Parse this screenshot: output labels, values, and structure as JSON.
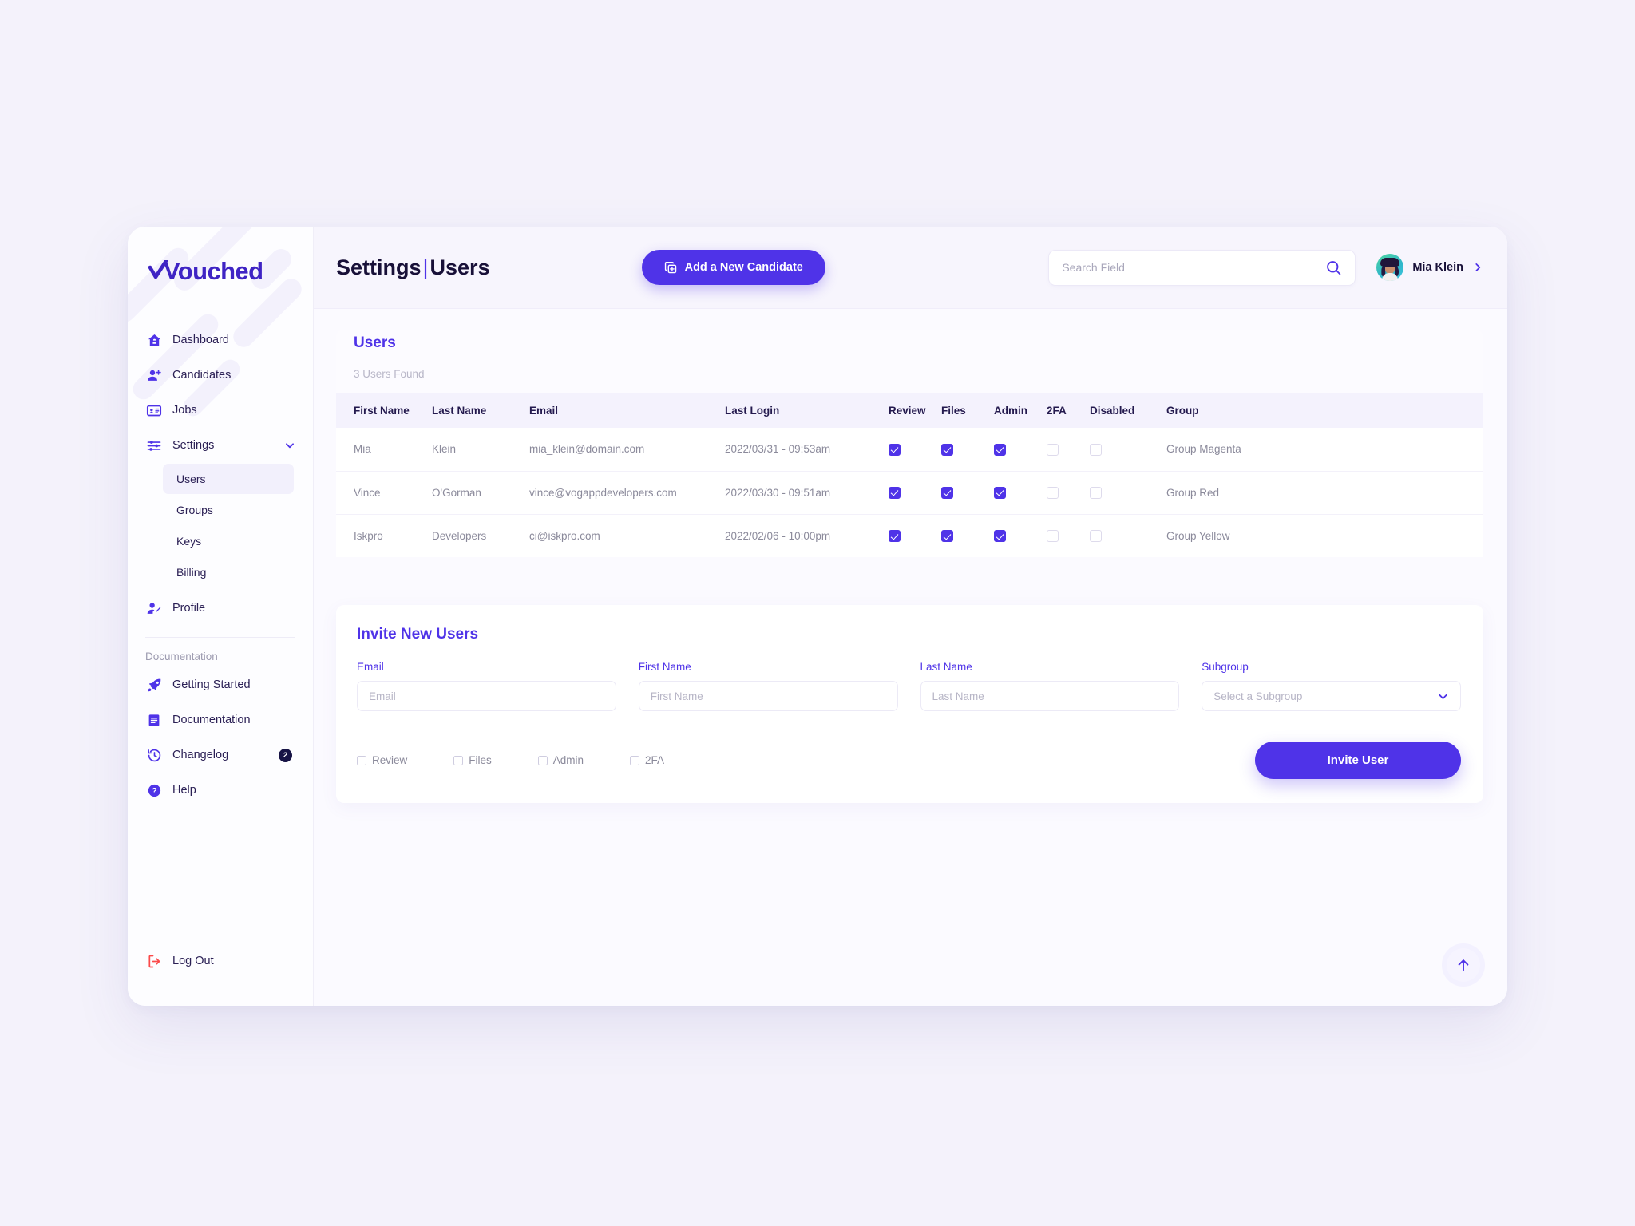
{
  "brand": {
    "name": "Vouched",
    "color": "#3f24c4"
  },
  "theme": {
    "accent": "#4f33e8",
    "page_bg": "#f4f2fb",
    "panel_bg": "#ffffff",
    "logout_color": "#fb4a4a"
  },
  "sidebar": {
    "primary": [
      {
        "label": "Dashboard",
        "icon": "home-icon"
      },
      {
        "label": "Candidates",
        "icon": "user-plus-icon"
      },
      {
        "label": "Jobs",
        "icon": "id-card-icon"
      },
      {
        "label": "Settings",
        "icon": "sliders-icon",
        "chevron": "chevron-down-icon"
      }
    ],
    "settings_sub": [
      {
        "label": "Users",
        "active": true
      },
      {
        "label": "Groups",
        "active": false
      },
      {
        "label": "Keys",
        "active": false
      },
      {
        "label": "Billing",
        "active": false
      }
    ],
    "profile": {
      "label": "Profile",
      "icon": "user-edit-icon"
    },
    "section_label": "Documentation",
    "docs": [
      {
        "label": "Getting Started",
        "icon": "rocket-icon"
      },
      {
        "label": "Documentation",
        "icon": "book-icon"
      },
      {
        "label": "Changelog",
        "icon": "history-icon",
        "badge": "2"
      },
      {
        "label": "Help",
        "icon": "question-circle-icon"
      }
    ],
    "logout": {
      "label": "Log Out",
      "icon": "logout-icon"
    }
  },
  "topbar": {
    "title_left": "Settings",
    "title_sep": "|",
    "title_right": "Users",
    "add_button": "Add a New Candidate",
    "add_button_icon": "copy-plus-icon",
    "search_placeholder": "Search Field",
    "search_value": "",
    "search_icon": "search-icon",
    "user_name": "Mia Klein",
    "user_chevron": "chevron-right-icon"
  },
  "users_panel": {
    "title": "Users",
    "count_text": "3 Users Found",
    "columns": [
      "First Name",
      "Last Name",
      "Email",
      "Last Login",
      "Review",
      "Files",
      "Admin",
      "2FA",
      "Disabled",
      "Group"
    ],
    "rows": [
      {
        "first_name": "Mia",
        "last_name": "Klein",
        "email": "mia_klein@domain.com",
        "last_login": "2022/03/31 - 09:53am",
        "review": true,
        "files": true,
        "admin": true,
        "twofa": false,
        "disabled": false,
        "group": "Group Magenta"
      },
      {
        "first_name": "Vince",
        "last_name": "O'Gorman",
        "email": "vince@vogappdevelopers.com",
        "last_login": "2022/03/30 - 09:51am",
        "review": true,
        "files": true,
        "admin": true,
        "twofa": false,
        "disabled": false,
        "group": "Group Red"
      },
      {
        "first_name": "Iskpro",
        "last_name": "Developers",
        "email": "ci@iskpro.com",
        "last_login": "2022/02/06 - 10:00pm",
        "review": true,
        "files": true,
        "admin": true,
        "twofa": false,
        "disabled": false,
        "group": "Group Yellow"
      }
    ]
  },
  "invite_panel": {
    "title": "Invite New Users",
    "fields": [
      {
        "label": "Email",
        "placeholder": "Email",
        "value": ""
      },
      {
        "label": "First Name",
        "placeholder": "First Name",
        "value": ""
      },
      {
        "label": "Last Name",
        "placeholder": "Last Name",
        "value": ""
      }
    ],
    "subgroup": {
      "label": "Subgroup",
      "selected": "Select a Subgroup",
      "chevron": "chevron-down-icon"
    },
    "checkboxes": [
      {
        "label": "Review",
        "checked": false
      },
      {
        "label": "Files",
        "checked": false
      },
      {
        "label": "Admin",
        "checked": false
      },
      {
        "label": "2FA",
        "checked": false
      }
    ],
    "submit": "Invite User"
  },
  "scroll_top_icon": "arrow-up-icon"
}
